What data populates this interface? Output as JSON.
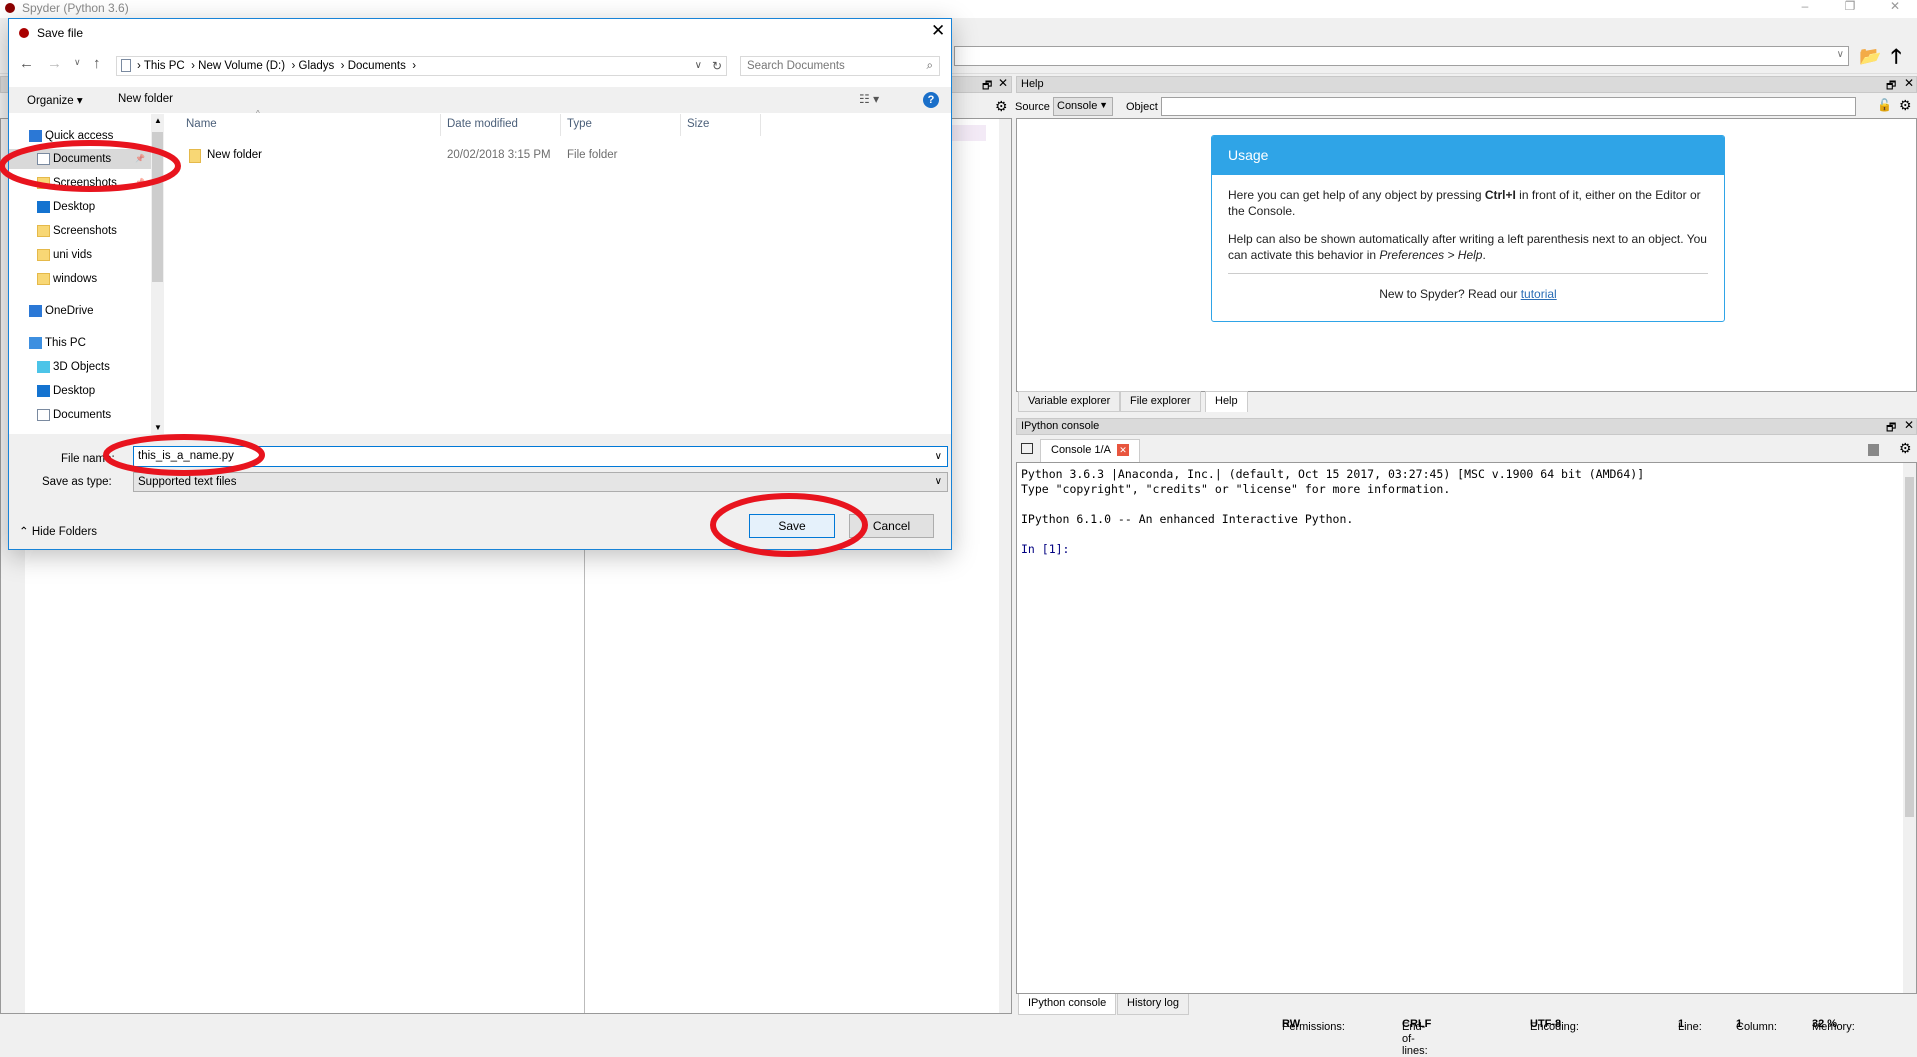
{
  "app": {
    "title": "Spyder (Python 3.6)",
    "window_controls": [
      "minimize",
      "restore",
      "close"
    ]
  },
  "left_pane": {
    "float_icon": "undock-icon",
    "close_icon": "close-icon"
  },
  "help": {
    "title": "Help",
    "source_label": "Source",
    "source_value": "Console",
    "object_label": "Object",
    "object_value": "",
    "usage": {
      "title": "Usage",
      "p1_pre": "Here you can get help of any object by pressing ",
      "p1_bold": "Ctrl+I",
      "p1_post": " in front of it, either on the Editor or the Console.",
      "p2_pre": "Help can also be shown automatically after writing a left parenthesis next to an object. You can activate this behavior in ",
      "p2_italic": "Preferences > Help",
      "p2_post": ".",
      "footer_pre": "New to Spyder? Read our ",
      "footer_link": "tutorial"
    },
    "accent": "#2fa4e7"
  },
  "top_tabs": [
    {
      "label": "Variable explorer"
    },
    {
      "label": "File explorer"
    },
    {
      "label": "Help",
      "selected": true
    }
  ],
  "console": {
    "title": "IPython console",
    "tab": "Console 1/A",
    "lines": [
      "Python 3.6.3 |Anaconda, Inc.| (default, Oct 15 2017, 03:27:45) [MSC v.1900 64 bit (AMD64)]",
      "Type \"copyright\", \"credits\" or \"license\" for more information.",
      "IPython 6.1.0 -- An enhanced Interactive Python."
    ],
    "prompt": "In [1]:"
  },
  "bottom_tabs": [
    {
      "label": "IPython console",
      "selected": true
    },
    {
      "label": "History log"
    }
  ],
  "status": {
    "permissions_label": "Permissions:",
    "permissions": "RW",
    "eol_label": "End-of-lines:",
    "eol": "CRLF",
    "encoding_label": "Encoding:",
    "encoding": "UTF-8",
    "line_label": "Line:",
    "line": "1",
    "column_label": "Column:",
    "column": "1",
    "memory_label": "Memory:",
    "memory": "32 %"
  },
  "dialog": {
    "title": "Save file",
    "breadcrumb": [
      "This PC",
      "New Volume (D:)",
      "Gladys",
      "Documents"
    ],
    "search_placeholder": "Search Documents",
    "organize": "Organize",
    "new_folder": "New folder",
    "nav": [
      {
        "label": "Quick access",
        "icon": "star-icon",
        "level": 0
      },
      {
        "label": "Documents",
        "icon": "documents-icon",
        "level": 1,
        "selected": true,
        "pinned": true
      },
      {
        "label": "Screenshots",
        "icon": "folder-icon",
        "level": 1,
        "pinned": true
      },
      {
        "label": "Desktop",
        "icon": "desktop-icon",
        "level": 1
      },
      {
        "label": "Screenshots",
        "icon": "folder-icon",
        "level": 1
      },
      {
        "label": "uni vids",
        "icon": "folder-icon",
        "level": 1
      },
      {
        "label": "windows",
        "icon": "folder-icon",
        "level": 1
      },
      {
        "label": "OneDrive",
        "icon": "cloud-icon",
        "level": 0
      },
      {
        "label": "This PC",
        "icon": "computer-icon",
        "level": 0
      },
      {
        "label": "3D Objects",
        "icon": "cube-icon",
        "level": 1
      },
      {
        "label": "Desktop",
        "icon": "desktop-icon",
        "level": 1
      },
      {
        "label": "Documents",
        "icon": "documents-icon",
        "level": 1
      }
    ],
    "columns": [
      "Name",
      "Date modified",
      "Type",
      "Size"
    ],
    "files": [
      {
        "name": "New folder",
        "date": "20/02/2018 3:15 PM",
        "type": "File folder",
        "size": ""
      }
    ],
    "file_name_label": "File name:",
    "file_name": "this_is_a_name.py",
    "save_type_label": "Save as type:",
    "save_type": "Supported text files",
    "hide_folders": "Hide Folders",
    "save": "Save",
    "cancel": "Cancel"
  },
  "annotations": {
    "color": "#e8141e",
    "highlighted": [
      "Documents",
      "File name",
      "Save"
    ]
  }
}
